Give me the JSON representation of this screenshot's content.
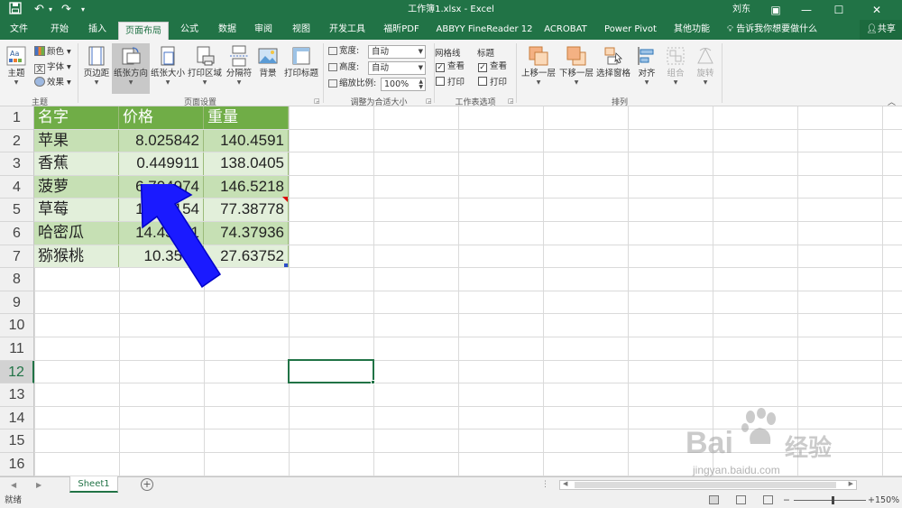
{
  "app": {
    "title": "工作簿1.xlsx  -  Excel",
    "user": "刘东",
    "tell_me": "告诉我你想要做什么",
    "share": "共享"
  },
  "tabs": [
    "文件",
    "开始",
    "插入",
    "页面布局",
    "公式",
    "数据",
    "审阅",
    "视图",
    "开发工具",
    "福昕PDF",
    "ABBYY FineReader 12",
    "ACROBAT",
    "Power Pivot",
    "其他功能"
  ],
  "active_tab": "页面布局",
  "ribbon": {
    "theme_group": {
      "label": "主题",
      "themes": "主题",
      "colors": "颜色",
      "fonts": "字体",
      "effects": "效果"
    },
    "page_setup": {
      "label": "页面设置",
      "margins": "页边距",
      "orientation": "纸张方向",
      "size": "纸张大小",
      "print_area": "打印区域",
      "breaks": "分隔符",
      "background": "背景",
      "print_titles": "打印标题"
    },
    "scale": {
      "label": "调整为合适大小",
      "width_label": "宽度:",
      "width_value": "自动",
      "height_label": "高度:",
      "height_value": "自动",
      "scale_label": "缩放比例:",
      "scale_value": "100%"
    },
    "sheet_options": {
      "label": "工作表选项",
      "gridlines": "网格线",
      "headings": "标题",
      "view": "查看",
      "print": "打印"
    },
    "arrange": {
      "label": "排列",
      "bring_forward": "上移一层",
      "send_backward": "下移一层",
      "selection_pane": "选择窗格",
      "align": "对齐",
      "group": "组合",
      "rotate": "旋转"
    }
  },
  "sheet": {
    "row_numbers": [
      "1",
      "2",
      "3",
      "4",
      "5",
      "6",
      "7",
      "8",
      "9",
      "10",
      "11",
      "12",
      "13",
      "14",
      "15",
      "16"
    ],
    "selected_row": "12",
    "headers": [
      "名字",
      "价格",
      "重量"
    ],
    "rows": [
      [
        "苹果",
        "8.025842",
        "140.4591"
      ],
      [
        "香蕉",
        "0.449911",
        "138.0405"
      ],
      [
        "菠萝",
        "6.704974",
        "146.5218"
      ],
      [
        "草莓",
        "14.36154",
        "77.38778"
      ],
      [
        "哈密瓜",
        "14.45641",
        "74.37936"
      ],
      [
        "猕猴桃",
        "10.3576",
        "27.63752"
      ]
    ],
    "header_fill": "#70ad47",
    "band_dark": "#c6e0b4",
    "band_light": "#e2efda",
    "tab_name": "Sheet1"
  },
  "status": {
    "text": "就绪",
    "zoom": "150%"
  },
  "watermark": {
    "brand": "Bai",
    "cn": "经验",
    "url": "jingyan.baidu.com"
  },
  "colors": {
    "excel_green": "#217346",
    "arrow_blue": "#1a1aff"
  }
}
